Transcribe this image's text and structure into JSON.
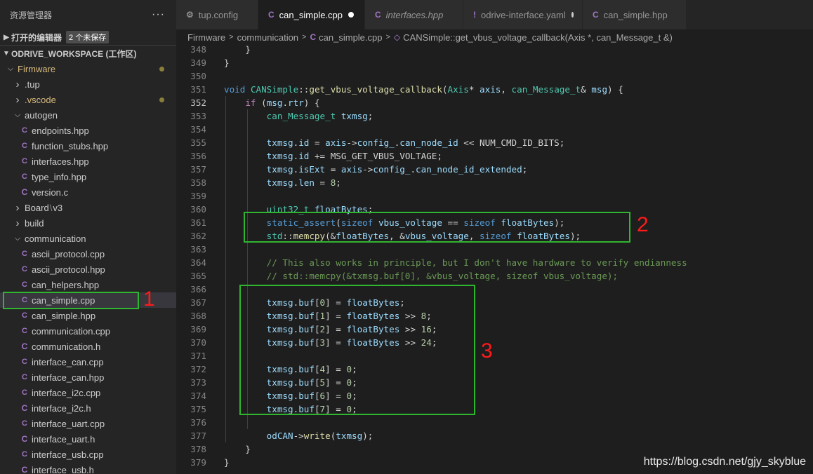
{
  "sidebar": {
    "title": "资源管理器",
    "more": "···",
    "open_editors": {
      "label": "打开的编辑器",
      "badge": "2 个未保存"
    },
    "workspace": {
      "label": "ODRIVE_WORKSPACE (工作区)"
    },
    "tree": [
      {
        "name": "Firmware",
        "kind": "folder-open",
        "modified": true
      },
      {
        "name": ".tup",
        "kind": "folder"
      },
      {
        "name": ".vscode",
        "kind": "folder",
        "modified": true
      },
      {
        "name": "autogen",
        "kind": "folder-open"
      },
      {
        "name": "endpoints.hpp",
        "kind": "cpp"
      },
      {
        "name": "function_stubs.hpp",
        "kind": "cpp"
      },
      {
        "name": "interfaces.hpp",
        "kind": "cpp"
      },
      {
        "name": "type_info.hpp",
        "kind": "cpp"
      },
      {
        "name": "version.c",
        "kind": "c"
      },
      {
        "name": "Board",
        "name2": "v3",
        "kind": "folder"
      },
      {
        "name": "build",
        "kind": "folder"
      },
      {
        "name": "communication",
        "kind": "folder-open"
      },
      {
        "name": "ascii_protocol.cpp",
        "kind": "cpp"
      },
      {
        "name": "ascii_protocol.hpp",
        "kind": "cpp"
      },
      {
        "name": "can_helpers.hpp",
        "kind": "cpp"
      },
      {
        "name": "can_simple.cpp",
        "kind": "cpp",
        "selected": true
      },
      {
        "name": "can_simple.hpp",
        "kind": "cpp"
      },
      {
        "name": "communication.cpp",
        "kind": "cpp"
      },
      {
        "name": "communication.h",
        "kind": "c"
      },
      {
        "name": "interface_can.cpp",
        "kind": "cpp"
      },
      {
        "name": "interface_can.hpp",
        "kind": "cpp"
      },
      {
        "name": "interface_i2c.cpp",
        "kind": "cpp"
      },
      {
        "name": "interface_i2c.h",
        "kind": "c"
      },
      {
        "name": "interface_uart.cpp",
        "kind": "cpp"
      },
      {
        "name": "interface_uart.h",
        "kind": "c"
      },
      {
        "name": "interface_usb.cpp",
        "kind": "cpp"
      },
      {
        "name": "interface_usb.h",
        "kind": "c"
      }
    ]
  },
  "tabs": [
    {
      "label": "tup.config",
      "icon": "gear-icon",
      "icon_glyph": "⚙",
      "active": false,
      "italic": false,
      "modified": false
    },
    {
      "label": "can_simple.cpp",
      "icon": "cpp-file-icon",
      "icon_glyph": "C",
      "active": true,
      "italic": false,
      "modified": true
    },
    {
      "label": "interfaces.hpp",
      "icon": "cpp-file-icon",
      "icon_glyph": "C",
      "active": false,
      "italic": true,
      "modified": false
    },
    {
      "label": "odrive-interface.yaml",
      "icon": "yaml-file-icon",
      "icon_glyph": "!",
      "active": false,
      "italic": false,
      "modified": true
    },
    {
      "label": "can_simple.hpp",
      "icon": "cpp-file-icon",
      "icon_glyph": "C",
      "active": false,
      "italic": false,
      "modified": false
    }
  ],
  "breadcrumb": {
    "items": [
      "Firmware",
      "communication",
      "can_simple.cpp",
      "CANSimple::get_vbus_voltage_callback(Axis *, can_Message_t &)"
    ],
    "sep": ">"
  },
  "editor": {
    "current_line": 352,
    "lines": [
      {
        "n": "348",
        "t": [
          [
            "    }",
            ""
          ]
        ]
      },
      {
        "n": "349",
        "t": [
          [
            "}",
            ""
          ]
        ]
      },
      {
        "n": "350",
        "t": []
      },
      {
        "n": "351",
        "t": [
          [
            "void",
            "kw"
          ],
          [
            " ",
            ""
          ],
          [
            "CANSimple",
            "ty"
          ],
          [
            "::",
            ""
          ],
          [
            "get_vbus_voltage_callback",
            "fn"
          ],
          [
            "(",
            ""
          ],
          [
            "Axis",
            "ty"
          ],
          [
            "* ",
            ""
          ],
          [
            "axis",
            "va"
          ],
          [
            ", ",
            ""
          ],
          [
            "can_Message_t",
            "ty"
          ],
          [
            "& ",
            ""
          ],
          [
            "msg",
            "va"
          ],
          [
            ") {",
            ""
          ]
        ]
      },
      {
        "n": "352",
        "t": [
          [
            "    ",
            ""
          ],
          [
            "if",
            "ct"
          ],
          [
            " (",
            ""
          ],
          [
            "msg",
            "va"
          ],
          [
            ".",
            ""
          ],
          [
            "rtr",
            "va"
          ],
          [
            ") {",
            ""
          ]
        ]
      },
      {
        "n": "353",
        "t": [
          [
            "        ",
            ""
          ],
          [
            "can_Message_t",
            "ty"
          ],
          [
            " ",
            ""
          ],
          [
            "txmsg",
            "va"
          ],
          [
            ";",
            ""
          ]
        ]
      },
      {
        "n": "354",
        "t": []
      },
      {
        "n": "355",
        "t": [
          [
            "        ",
            ""
          ],
          [
            "txmsg",
            "va"
          ],
          [
            ".",
            ""
          ],
          [
            "id",
            "va"
          ],
          [
            " = ",
            ""
          ],
          [
            "axis",
            "va"
          ],
          [
            "->",
            ""
          ],
          [
            "config_",
            "va"
          ],
          [
            ".",
            ""
          ],
          [
            "can_node_id",
            "va"
          ],
          [
            " << NUM_CMD_ID_BITS;",
            ""
          ]
        ]
      },
      {
        "n": "356",
        "t": [
          [
            "        ",
            ""
          ],
          [
            "txmsg",
            "va"
          ],
          [
            ".",
            ""
          ],
          [
            "id",
            "va"
          ],
          [
            " += MSG_GET_VBUS_VOLTAGE;",
            ""
          ]
        ]
      },
      {
        "n": "357",
        "t": [
          [
            "        ",
            ""
          ],
          [
            "txmsg",
            "va"
          ],
          [
            ".",
            ""
          ],
          [
            "isExt",
            "va"
          ],
          [
            " = ",
            ""
          ],
          [
            "axis",
            "va"
          ],
          [
            "->",
            ""
          ],
          [
            "config_",
            "va"
          ],
          [
            ".",
            ""
          ],
          [
            "can_node_id_extended",
            "va"
          ],
          [
            ";",
            ""
          ]
        ]
      },
      {
        "n": "358",
        "t": [
          [
            "        ",
            ""
          ],
          [
            "txmsg",
            "va"
          ],
          [
            ".",
            ""
          ],
          [
            "len",
            "va"
          ],
          [
            " = ",
            ""
          ],
          [
            "8",
            "num"
          ],
          [
            ";",
            ""
          ]
        ]
      },
      {
        "n": "359",
        "t": []
      },
      {
        "n": "360",
        "t": [
          [
            "        ",
            ""
          ],
          [
            "uint32_t",
            "ty"
          ],
          [
            " ",
            ""
          ],
          [
            "floatBytes",
            "va"
          ],
          [
            ";",
            ""
          ]
        ]
      },
      {
        "n": "361",
        "t": [
          [
            "        ",
            ""
          ],
          [
            "static_assert",
            "kw"
          ],
          [
            "(",
            ""
          ],
          [
            "sizeof",
            "kw"
          ],
          [
            " ",
            ""
          ],
          [
            "vbus_voltage",
            "va"
          ],
          [
            " == ",
            ""
          ],
          [
            "sizeof",
            "kw"
          ],
          [
            " ",
            ""
          ],
          [
            "floatBytes",
            "va"
          ],
          [
            ");",
            ""
          ]
        ]
      },
      {
        "n": "362",
        "t": [
          [
            "        ",
            ""
          ],
          [
            "std",
            "ty"
          ],
          [
            "::",
            ""
          ],
          [
            "memcpy",
            "fn"
          ],
          [
            "(&",
            ""
          ],
          [
            "floatBytes",
            "va"
          ],
          [
            ", &",
            ""
          ],
          [
            "vbus_voltage",
            "va"
          ],
          [
            ", ",
            ""
          ],
          [
            "sizeof",
            "kw"
          ],
          [
            " ",
            ""
          ],
          [
            "floatBytes",
            "va"
          ],
          [
            ");",
            ""
          ]
        ]
      },
      {
        "n": "363",
        "t": []
      },
      {
        "n": "364",
        "t": [
          [
            "        ",
            ""
          ],
          [
            "// This also works in principle, but I don't have hardware to verify endianness",
            "cm"
          ]
        ]
      },
      {
        "n": "365",
        "t": [
          [
            "        ",
            ""
          ],
          [
            "// std::memcpy(&txmsg.buf[0], &vbus_voltage, sizeof vbus_voltage);",
            "cm"
          ]
        ]
      },
      {
        "n": "366",
        "t": []
      },
      {
        "n": "367",
        "t": [
          [
            "        ",
            ""
          ],
          [
            "txmsg",
            "va"
          ],
          [
            ".",
            ""
          ],
          [
            "buf",
            "va"
          ],
          [
            "[",
            ""
          ],
          [
            "0",
            "num"
          ],
          [
            "] = ",
            ""
          ],
          [
            "floatBytes",
            "va"
          ],
          [
            ";",
            ""
          ]
        ]
      },
      {
        "n": "368",
        "t": [
          [
            "        ",
            ""
          ],
          [
            "txmsg",
            "va"
          ],
          [
            ".",
            ""
          ],
          [
            "buf",
            "va"
          ],
          [
            "[",
            ""
          ],
          [
            "1",
            "num"
          ],
          [
            "] = ",
            ""
          ],
          [
            "floatBytes",
            "va"
          ],
          [
            " >> ",
            ""
          ],
          [
            "8",
            "num"
          ],
          [
            ";",
            ""
          ]
        ]
      },
      {
        "n": "369",
        "t": [
          [
            "        ",
            ""
          ],
          [
            "txmsg",
            "va"
          ],
          [
            ".",
            ""
          ],
          [
            "buf",
            "va"
          ],
          [
            "[",
            ""
          ],
          [
            "2",
            "num"
          ],
          [
            "] = ",
            ""
          ],
          [
            "floatBytes",
            "va"
          ],
          [
            " >> ",
            ""
          ],
          [
            "16",
            "num"
          ],
          [
            ";",
            ""
          ]
        ]
      },
      {
        "n": "370",
        "t": [
          [
            "        ",
            ""
          ],
          [
            "txmsg",
            "va"
          ],
          [
            ".",
            ""
          ],
          [
            "buf",
            "va"
          ],
          [
            "[",
            ""
          ],
          [
            "3",
            "num"
          ],
          [
            "] = ",
            ""
          ],
          [
            "floatBytes",
            "va"
          ],
          [
            " >> ",
            ""
          ],
          [
            "24",
            "num"
          ],
          [
            ";",
            ""
          ]
        ]
      },
      {
        "n": "371",
        "t": []
      },
      {
        "n": "372",
        "t": [
          [
            "        ",
            ""
          ],
          [
            "txmsg",
            "va"
          ],
          [
            ".",
            ""
          ],
          [
            "buf",
            "va"
          ],
          [
            "[",
            ""
          ],
          [
            "4",
            "num"
          ],
          [
            "] = ",
            ""
          ],
          [
            "0",
            "num"
          ],
          [
            ";",
            ""
          ]
        ]
      },
      {
        "n": "373",
        "t": [
          [
            "        ",
            ""
          ],
          [
            "txmsg",
            "va"
          ],
          [
            ".",
            ""
          ],
          [
            "buf",
            "va"
          ],
          [
            "[",
            ""
          ],
          [
            "5",
            "num"
          ],
          [
            "] = ",
            ""
          ],
          [
            "0",
            "num"
          ],
          [
            ";",
            ""
          ]
        ]
      },
      {
        "n": "374",
        "t": [
          [
            "        ",
            ""
          ],
          [
            "txmsg",
            "va"
          ],
          [
            ".",
            ""
          ],
          [
            "buf",
            "va"
          ],
          [
            "[",
            ""
          ],
          [
            "6",
            "num"
          ],
          [
            "] = ",
            ""
          ],
          [
            "0",
            "num"
          ],
          [
            ";",
            ""
          ]
        ]
      },
      {
        "n": "375",
        "t": [
          [
            "        ",
            ""
          ],
          [
            "txmsg",
            "va"
          ],
          [
            ".",
            ""
          ],
          [
            "buf",
            "va"
          ],
          [
            "[",
            ""
          ],
          [
            "7",
            "num"
          ],
          [
            "] = ",
            ""
          ],
          [
            "0",
            "num"
          ],
          [
            ";",
            ""
          ]
        ]
      },
      {
        "n": "376",
        "t": []
      },
      {
        "n": "377",
        "t": [
          [
            "        ",
            ""
          ],
          [
            "odCAN",
            "va"
          ],
          [
            "->",
            ""
          ],
          [
            "write",
            "fn"
          ],
          [
            "(",
            ""
          ],
          [
            "txmsg",
            "va"
          ],
          [
            ");",
            ""
          ]
        ]
      },
      {
        "n": "378",
        "t": [
          [
            "    }",
            ""
          ]
        ]
      },
      {
        "n": "379",
        "t": [
          [
            "}",
            ""
          ]
        ]
      }
    ]
  },
  "annotations": [
    "1",
    "2",
    "3"
  ],
  "watermark": "https://blog.csdn.net/gjy_skyblue",
  "colors": {
    "highlight_box": "#2fb52f",
    "annotation": "#ff1a1a"
  }
}
